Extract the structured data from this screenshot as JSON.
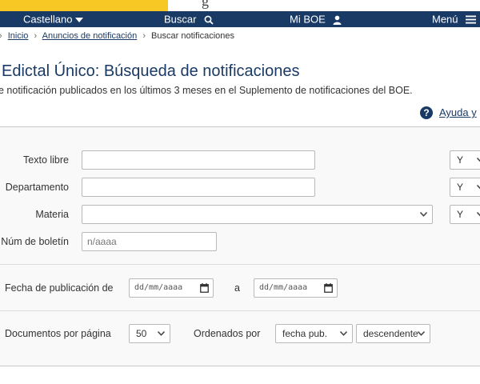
{
  "top_strip": {
    "partial_text": "g"
  },
  "nav": {
    "language": "Castellano",
    "search": "Buscar",
    "my_boe": "Mi BOE",
    "menu": "Menú"
  },
  "breadcrumb": {
    "items": [
      "Inicio",
      "Anuncios de notificación",
      "Buscar notificaciones"
    ]
  },
  "page": {
    "title": "Edictal Único: Búsqueda de notificaciones",
    "subtitle": "e notificación publicados en los últimos 3 meses en el Suplemento de notificaciones del BOE.",
    "help_label": "Ayuda y"
  },
  "form": {
    "texto_libre": {
      "label": "Texto libre",
      "value": "",
      "op": "Y"
    },
    "departamento": {
      "label": "Departamento",
      "value": "",
      "op": "Y"
    },
    "materia": {
      "label": "Materia",
      "value": "",
      "op": "Y"
    },
    "num_boletin": {
      "label": "Núm de boletín",
      "placeholder": "n/aaaa"
    },
    "fecha": {
      "label": "Fecha de publicación de",
      "from_placeholder": "dd/mm/aaaa",
      "connector": "a",
      "to_placeholder": "dd/mm/aaaa"
    },
    "documentos": {
      "label": "Documentos por página",
      "value": "50"
    },
    "ordenados": {
      "label": "Ordenados por",
      "field": "fecha pub.",
      "direction": "descendente"
    }
  },
  "colors": {
    "nav_bg": "#1a3a66",
    "accent_yellow": "#f7c823",
    "link": "#1a3a66"
  }
}
